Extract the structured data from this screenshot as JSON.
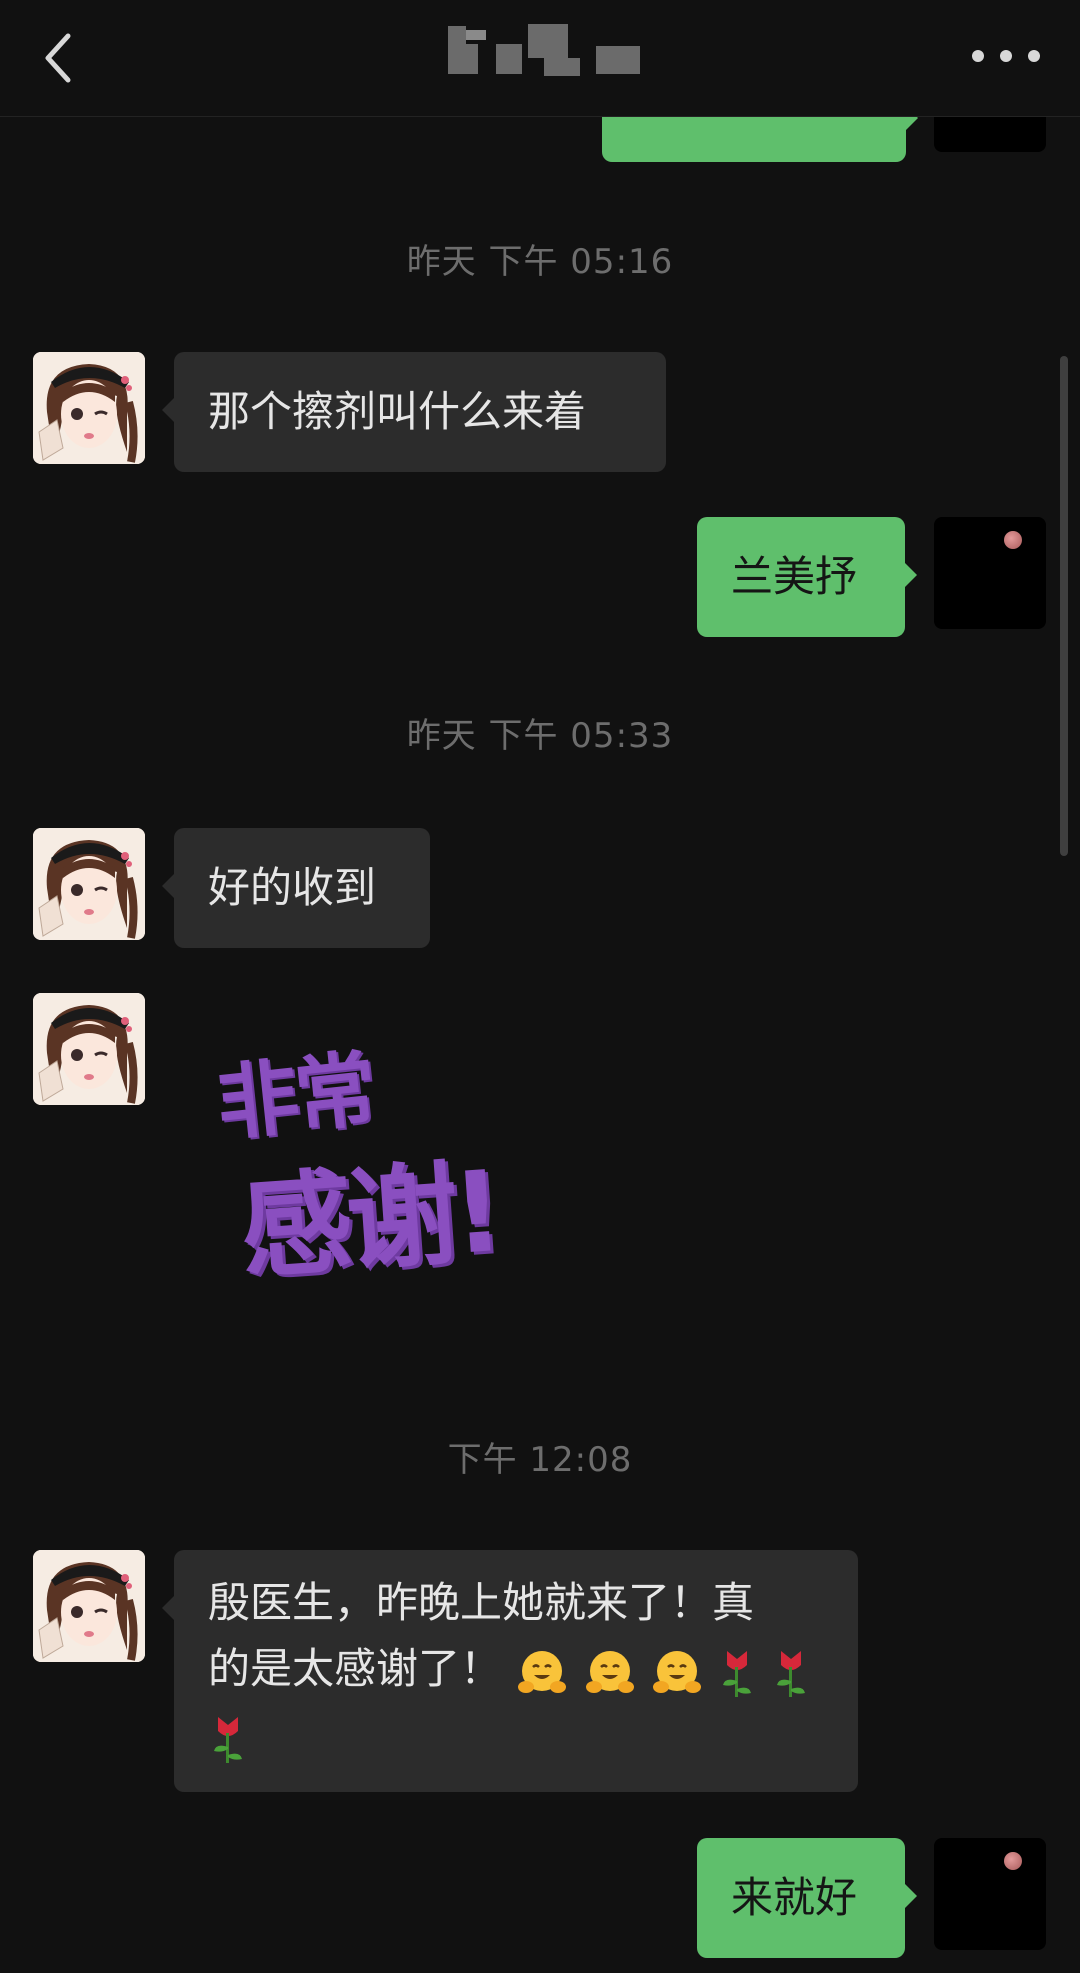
{
  "header": {
    "title": "",
    "back_icon": "chevron-left-icon",
    "more_icon": "more-dots-icon"
  },
  "messages": {
    "partial_top": {
      "side": "right",
      "text": ""
    },
    "time_1": "昨天 下午 05:16",
    "msg_1": {
      "side": "left",
      "text": "那个擦剂叫什么来着"
    },
    "msg_2": {
      "side": "right",
      "text": "兰美抒"
    },
    "time_2": "昨天 下午 05:33",
    "msg_3": {
      "side": "left",
      "text": "好的收到"
    },
    "sticker": {
      "side": "left",
      "line1": "非常",
      "line2": "感谢!"
    },
    "time_3": "下午 12:08",
    "msg_5": {
      "side": "left",
      "line1": "殷医生，昨晚上她就来了！真",
      "line2": "的是太感谢了！",
      "emojis": [
        "hugging-face",
        "hugging-face",
        "hugging-face",
        "rose",
        "rose",
        "rose"
      ]
    },
    "msg_6": {
      "side": "right",
      "text": "来就好"
    }
  },
  "colors": {
    "background": "#111111",
    "incoming_bubble": "#2c2c2c",
    "outgoing_bubble": "#5fbf6c",
    "timestamp": "#6d6d6d",
    "sticker_purple": "#8a4fc0"
  }
}
